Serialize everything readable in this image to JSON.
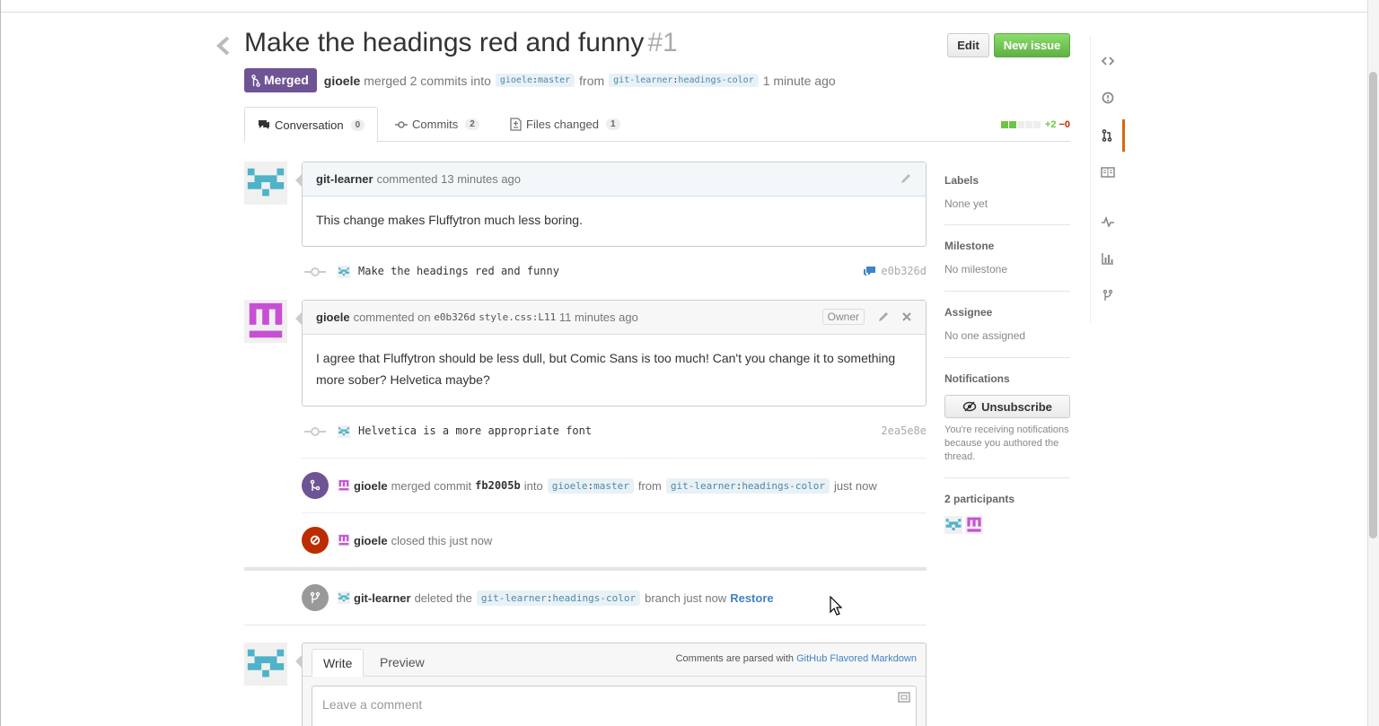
{
  "pr": {
    "title": "Make the headings red and funny",
    "number": "#1",
    "edit_label": "Edit",
    "new_issue_label": "New issue",
    "state": "Merged",
    "merger": "gioele",
    "merge_text": "merged 2 commits into",
    "base_owner": "gioele",
    "base_branch": "master",
    "from_text": "from",
    "head_owner": "git-learner",
    "head_branch": "headings-color",
    "time": "1 minute ago"
  },
  "tabs": [
    {
      "label": "Conversation",
      "count": "0"
    },
    {
      "label": "Commits",
      "count": "2"
    },
    {
      "label": "Files changed",
      "count": "1"
    }
  ],
  "diffstat": {
    "additions": "+2",
    "deletions": "−0",
    "colors": [
      "#6cc644",
      "#6cc644",
      "#eeeeee",
      "#eeeeee",
      "#eeeeee"
    ]
  },
  "comment1": {
    "author": "git-learner",
    "action": "commented",
    "time": "13 minutes ago",
    "body": "This change makes Fluffytron much less boring."
  },
  "commit1": {
    "message": "Make the headings red and funny",
    "sha": "e0b326d"
  },
  "comment2": {
    "author": "gioele",
    "action": "commented on",
    "commit": "e0b326d",
    "location": "style.css:L11",
    "time": "11 minutes ago",
    "badge": "Owner",
    "body": "I agree that Fluffytron should be less dull, but Comic Sans is too much! Can't you change it to something more sober? Helvetica maybe?"
  },
  "commit2": {
    "message": "Helvetica is a more appropriate font",
    "sha": "2ea5e8e"
  },
  "event_merge": {
    "user": "gioele",
    "text": "merged commit",
    "sha": "fb2005b",
    "into": "into",
    "base_owner": "gioele",
    "base_branch": "master",
    "from": "from",
    "head_owner": "git-learner",
    "head_branch": "headings-color",
    "time": "just now"
  },
  "event_close": {
    "user": "gioele",
    "text": "closed this",
    "time": "just now"
  },
  "event_delete": {
    "user": "git-learner",
    "text": "deleted the",
    "owner": "git-learner",
    "branch": "headings-color",
    "after": "branch",
    "time": "just now",
    "restore": "Restore"
  },
  "new_comment": {
    "write_tab": "Write",
    "preview_tab": "Preview",
    "note": "Comments are parsed with",
    "note_link": "GitHub Flavored Markdown",
    "placeholder": "Leave a comment"
  },
  "sidebar": {
    "labels_h": "Labels",
    "labels_v": "None yet",
    "milestone_h": "Milestone",
    "milestone_v": "No milestone",
    "assignee_h": "Assignee",
    "assignee_v": "No one assigned",
    "notifications_h": "Notifications",
    "unsubscribe": "Unsubscribe",
    "notif_note": "You're receiving notifications because you authored the thread.",
    "participants_h": "2 participants"
  },
  "colors": {
    "merged": "#6e5494",
    "closed": "#bd2c00",
    "accent": "#d26911",
    "link": "#4183c4",
    "teal": "#4eb3c9",
    "magenta": "#c74fd4"
  }
}
